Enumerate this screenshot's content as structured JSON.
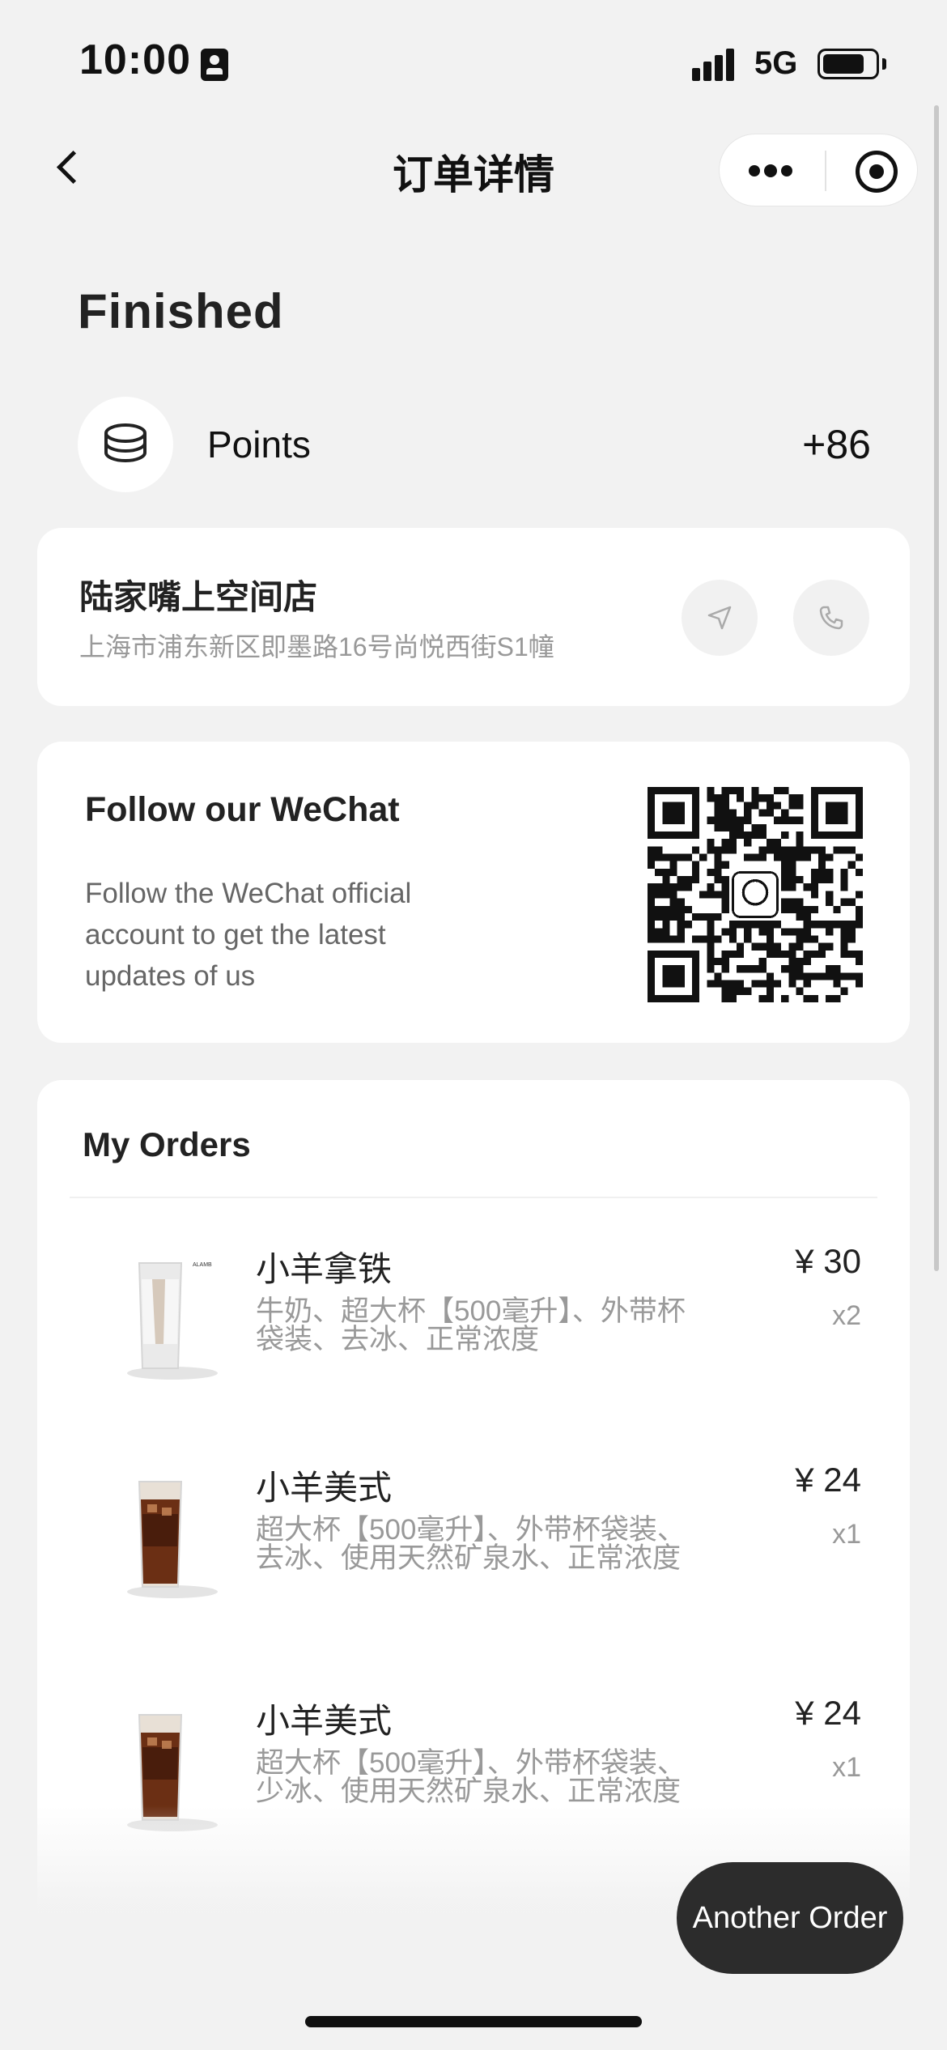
{
  "status_bar": {
    "time": "10:00",
    "network": "5G"
  },
  "nav": {
    "title": "订单详情"
  },
  "order": {
    "status": "Finished",
    "points_label": "Points",
    "points_value": "+86"
  },
  "store": {
    "name": "陆家嘴上空间店",
    "address": "上海市浦东新区即墨路16号尚悦西街S1幢"
  },
  "wechat": {
    "title": "Follow our WeChat",
    "description": "Follow the WeChat official account to get the latest updates of us"
  },
  "orders": {
    "title": "My Orders",
    "items": [
      {
        "name": "小羊拿铁",
        "options": "牛奶、超大杯【500毫升】、外带杯袋装、去冰、正常浓度",
        "price": "¥ 30",
        "qty": "x2",
        "image": "iced-latte-glass"
      },
      {
        "name": "小羊美式",
        "options": "超大杯【500毫升】、外带杯袋装、去冰、使用天然矿泉水、正常浓度",
        "price": "¥ 24",
        "qty": "x1",
        "image": "iced-americano-glass"
      },
      {
        "name": "小羊美式",
        "options": "超大杯【500毫升】、外带杯袋装、少冰、使用天然矿泉水、正常浓度",
        "price": "¥ 24",
        "qty": "x1",
        "image": "iced-americano-glass"
      }
    ]
  },
  "actions": {
    "another_order": "Another Order"
  },
  "colors": {
    "background": "#f2f2f2",
    "card": "#ffffff",
    "button_dark": "#2c2c2c",
    "muted_text": "#999999"
  }
}
